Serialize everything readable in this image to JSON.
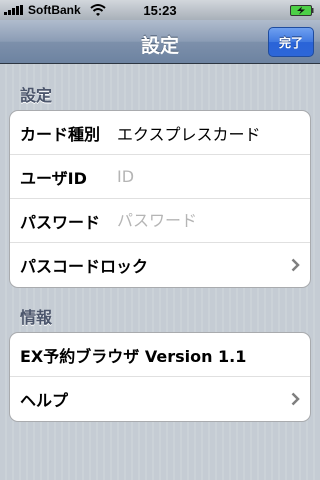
{
  "status_bar": {
    "carrier": "SoftBank",
    "time": "15:23",
    "icons": [
      "signal-icon",
      "wifi-icon",
      "battery-charging-icon"
    ]
  },
  "nav": {
    "title": "設定",
    "done_label": "完了"
  },
  "sections": [
    {
      "header": "設定",
      "rows": {
        "card_type": {
          "label": "カード種別",
          "value": "エクスプレスカード"
        },
        "user_id": {
          "label": "ユーザID",
          "placeholder": "ID",
          "value": ""
        },
        "password": {
          "label": "パスワード",
          "placeholder": "パスワード",
          "value": ""
        },
        "passcode_lock": {
          "label": "パスコードロック",
          "icon": "chevron-right-icon"
        }
      }
    },
    {
      "header": "情報",
      "rows": {
        "version": {
          "label": "EX予約ブラウザ Version 1.1"
        },
        "help": {
          "label": "ヘルプ",
          "icon": "chevron-right-icon"
        }
      }
    }
  ],
  "colors": {
    "background": "#c5ccd4",
    "nav_bar": "#6d83a1",
    "done_button": "#3f78e0",
    "section_header": "#4c566c",
    "placeholder": "#b5b5b5"
  }
}
